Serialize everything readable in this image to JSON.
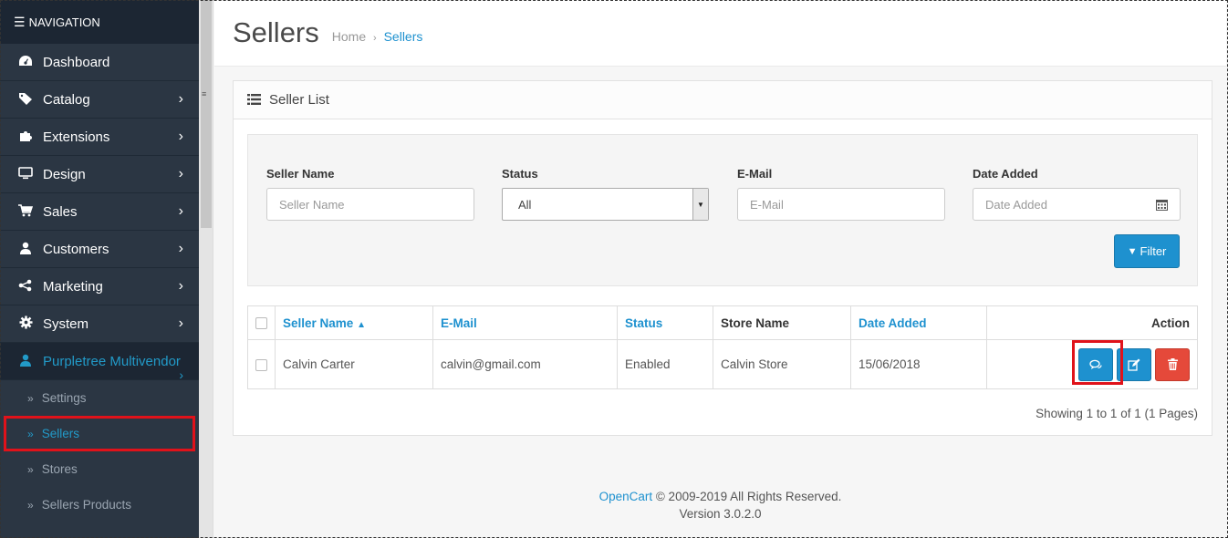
{
  "nav": {
    "header": "NAVIGATION",
    "items": [
      {
        "label": "Dashboard",
        "icon": "dashboard-icon"
      },
      {
        "label": "Catalog",
        "icon": "tag-icon"
      },
      {
        "label": "Extensions",
        "icon": "puzzle-icon"
      },
      {
        "label": "Design",
        "icon": "monitor-icon"
      },
      {
        "label": "Sales",
        "icon": "cart-icon"
      },
      {
        "label": "Customers",
        "icon": "user-icon"
      },
      {
        "label": "Marketing",
        "icon": "share-icon"
      },
      {
        "label": "System",
        "icon": "gear-icon"
      },
      {
        "label": "Purpletree Multivendor",
        "icon": "user-icon"
      }
    ],
    "subitems": [
      "Settings",
      "Sellers",
      "Stores",
      "Sellers Products"
    ]
  },
  "header": {
    "title": "Sellers",
    "breadcrumb": [
      "Home",
      "Sellers"
    ]
  },
  "panel": {
    "title": "Seller List",
    "filter": {
      "seller_name_label": "Seller Name",
      "seller_name_placeholder": "Seller Name",
      "status_label": "Status",
      "status_value": "All",
      "email_label": "E-Mail",
      "email_placeholder": "E-Mail",
      "date_label": "Date Added",
      "date_placeholder": "Date Added",
      "filter_button": "Filter"
    },
    "table": {
      "headers": {
        "seller_name": "Seller Name",
        "email": "E-Mail",
        "status": "Status",
        "store_name": "Store Name",
        "date_added": "Date Added",
        "action": "Action"
      },
      "rows": [
        {
          "seller_name": "Calvin Carter",
          "email": "calvin@gmail.com",
          "status": "Enabled",
          "store_name": "Calvin Store",
          "date_added": "15/06/2018"
        }
      ]
    },
    "pagination_text": "Showing 1 to 1 of 1 (1 Pages)"
  },
  "footer": {
    "brand": "OpenCart",
    "copyright": " © 2009-2019 All Rights Reserved.",
    "version": "Version 3.0.2.0"
  },
  "colors": {
    "sidebar_bg": "#2b3643",
    "accent": "#1e91cf",
    "danger": "#e5493a",
    "highlight": "#e0121a"
  }
}
